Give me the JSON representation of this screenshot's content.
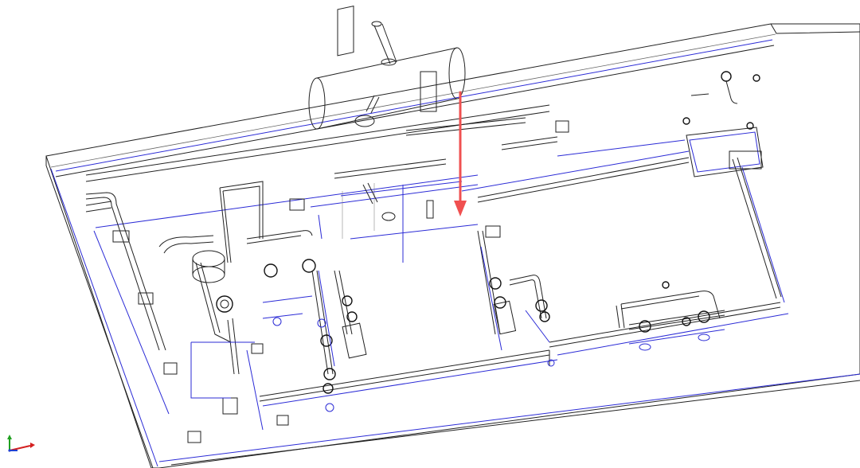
{
  "scene": {
    "colors": {
      "background": "#ffffff",
      "model_lines": "#222222",
      "centerlines": "#2b2bd6",
      "highlight_arrow": "#f05050",
      "axis_x": "#d42020",
      "axis_y": "#20a020",
      "axis_z": "#2040d0"
    },
    "axis_triad": {
      "icon": "xyz-axis-triad-icon"
    },
    "highlight": {
      "icon": "red-arrow-pointer-icon"
    }
  }
}
